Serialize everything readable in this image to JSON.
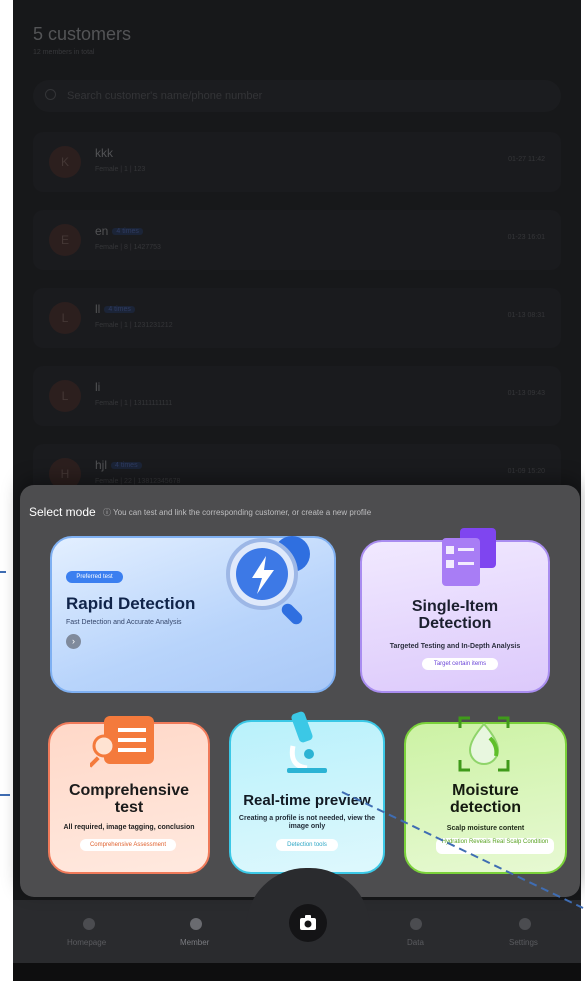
{
  "header": {
    "title": "5 customers",
    "subtitle": "12 members in total"
  },
  "search": {
    "placeholder": "Search customer's name/phone number"
  },
  "customers": [
    {
      "initial": "K",
      "name": "kkk",
      "tag": "",
      "info": "Female  |  1  |  123",
      "time": "01-27 11:42"
    },
    {
      "initial": "E",
      "name": "en",
      "tag": "4 times",
      "info": "Female  |  8  |  1427753",
      "time": "01-23 16:01"
    },
    {
      "initial": "L",
      "name": "ll",
      "tag": "4 times",
      "info": "Female  |  1  |  1231231212",
      "time": "01-13 08:31"
    },
    {
      "initial": "L",
      "name": "li",
      "tag": "",
      "info": "Female  |  1  |  13111111111",
      "time": "01-13 09:43"
    },
    {
      "initial": "H",
      "name": "hjl",
      "tag": "4 times",
      "info": "Female  |  22  |  13812345678",
      "time": "01-09 15:20"
    }
  ],
  "sheet": {
    "title": "Select mode",
    "hint": "You can test and link the corresponding customer, or create a new profile",
    "rapid": {
      "badge": "Preferred test",
      "title": "Rapid Detection",
      "desc": "Fast Detection and Accurate Analysis"
    },
    "single": {
      "title_line1": "Single-Item",
      "title_line2": "Detection",
      "desc": "Targeted Testing and In-Depth Analysis",
      "pill": "Target certain items"
    },
    "comprehensive": {
      "title_line1": "Comprehensive",
      "title_line2": "test",
      "desc": "All required, image tagging, conclusion",
      "pill": "Comprehensive Assessment"
    },
    "realtime": {
      "title": "Real-time preview",
      "desc": "Creating a profile is not needed, view the image only",
      "pill": "Detection tools"
    },
    "moisture": {
      "title_line1": "Moisture",
      "title_line2": "detection",
      "desc": "Scalp moisture content",
      "pill": "Hydration Reveals Real Scalp Condition"
    }
  },
  "nav": {
    "home": "Homepage",
    "member": "Member",
    "data": "Data",
    "settings": "Settings"
  },
  "colors": {
    "accent_blue": "#2f6fe0",
    "purple": "#8a5cf0",
    "orange": "#f07a3a",
    "cyan": "#3bc8e6",
    "green": "#6cc32a"
  }
}
